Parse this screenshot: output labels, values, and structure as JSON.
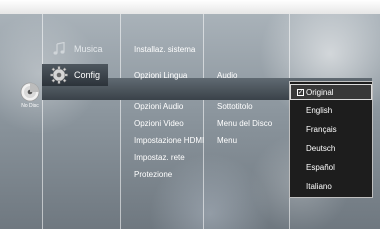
{
  "disc": {
    "label": "No Disc"
  },
  "categories": [
    {
      "label": "Musica",
      "icon": "music-note-icon"
    },
    {
      "label": "Config",
      "icon": "gear-icon"
    }
  ],
  "settings_menu": [
    "Installaz. sistema",
    "Opzioni Lingua",
    "Opzioni Audio",
    "Opzioni Video",
    "Impostazione HDMI",
    "Impostaz. rete",
    "Protezione"
  ],
  "language_submenu": [
    "Audio",
    "Sottotitolo",
    "Menu del Disco",
    "Menu"
  ],
  "dropdown": {
    "options": [
      "Original",
      "English",
      "Français",
      "Deutsch",
      "Español",
      "Italiano"
    ],
    "selected": "Original"
  }
}
